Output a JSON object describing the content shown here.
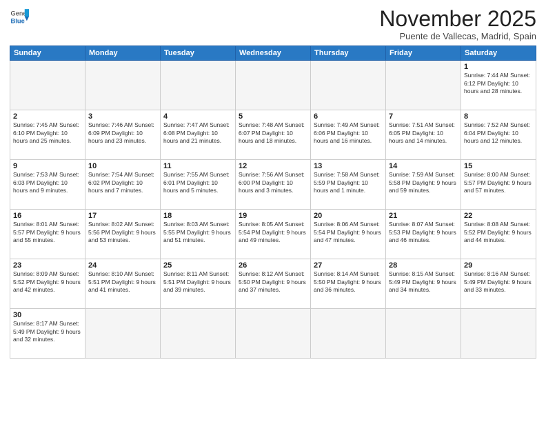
{
  "header": {
    "logo_general": "General",
    "logo_blue": "Blue",
    "title": "November 2025",
    "location": "Puente de Vallecas, Madrid, Spain"
  },
  "weekdays": [
    "Sunday",
    "Monday",
    "Tuesday",
    "Wednesday",
    "Thursday",
    "Friday",
    "Saturday"
  ],
  "weeks": [
    [
      {
        "day": "",
        "info": ""
      },
      {
        "day": "",
        "info": ""
      },
      {
        "day": "",
        "info": ""
      },
      {
        "day": "",
        "info": ""
      },
      {
        "day": "",
        "info": ""
      },
      {
        "day": "",
        "info": ""
      },
      {
        "day": "1",
        "info": "Sunrise: 7:44 AM\nSunset: 6:12 PM\nDaylight: 10 hours\nand 28 minutes."
      }
    ],
    [
      {
        "day": "2",
        "info": "Sunrise: 7:45 AM\nSunset: 6:10 PM\nDaylight: 10 hours\nand 25 minutes."
      },
      {
        "day": "3",
        "info": "Sunrise: 7:46 AM\nSunset: 6:09 PM\nDaylight: 10 hours\nand 23 minutes."
      },
      {
        "day": "4",
        "info": "Sunrise: 7:47 AM\nSunset: 6:08 PM\nDaylight: 10 hours\nand 21 minutes."
      },
      {
        "day": "5",
        "info": "Sunrise: 7:48 AM\nSunset: 6:07 PM\nDaylight: 10 hours\nand 18 minutes."
      },
      {
        "day": "6",
        "info": "Sunrise: 7:49 AM\nSunset: 6:06 PM\nDaylight: 10 hours\nand 16 minutes."
      },
      {
        "day": "7",
        "info": "Sunrise: 7:51 AM\nSunset: 6:05 PM\nDaylight: 10 hours\nand 14 minutes."
      },
      {
        "day": "8",
        "info": "Sunrise: 7:52 AM\nSunset: 6:04 PM\nDaylight: 10 hours\nand 12 minutes."
      }
    ],
    [
      {
        "day": "9",
        "info": "Sunrise: 7:53 AM\nSunset: 6:03 PM\nDaylight: 10 hours\nand 9 minutes."
      },
      {
        "day": "10",
        "info": "Sunrise: 7:54 AM\nSunset: 6:02 PM\nDaylight: 10 hours\nand 7 minutes."
      },
      {
        "day": "11",
        "info": "Sunrise: 7:55 AM\nSunset: 6:01 PM\nDaylight: 10 hours\nand 5 minutes."
      },
      {
        "day": "12",
        "info": "Sunrise: 7:56 AM\nSunset: 6:00 PM\nDaylight: 10 hours\nand 3 minutes."
      },
      {
        "day": "13",
        "info": "Sunrise: 7:58 AM\nSunset: 5:59 PM\nDaylight: 10 hours\nand 1 minute."
      },
      {
        "day": "14",
        "info": "Sunrise: 7:59 AM\nSunset: 5:58 PM\nDaylight: 9 hours\nand 59 minutes."
      },
      {
        "day": "15",
        "info": "Sunrise: 8:00 AM\nSunset: 5:57 PM\nDaylight: 9 hours\nand 57 minutes."
      }
    ],
    [
      {
        "day": "16",
        "info": "Sunrise: 8:01 AM\nSunset: 5:57 PM\nDaylight: 9 hours\nand 55 minutes."
      },
      {
        "day": "17",
        "info": "Sunrise: 8:02 AM\nSunset: 5:56 PM\nDaylight: 9 hours\nand 53 minutes."
      },
      {
        "day": "18",
        "info": "Sunrise: 8:03 AM\nSunset: 5:55 PM\nDaylight: 9 hours\nand 51 minutes."
      },
      {
        "day": "19",
        "info": "Sunrise: 8:05 AM\nSunset: 5:54 PM\nDaylight: 9 hours\nand 49 minutes."
      },
      {
        "day": "20",
        "info": "Sunrise: 8:06 AM\nSunset: 5:54 PM\nDaylight: 9 hours\nand 47 minutes."
      },
      {
        "day": "21",
        "info": "Sunrise: 8:07 AM\nSunset: 5:53 PM\nDaylight: 9 hours\nand 46 minutes."
      },
      {
        "day": "22",
        "info": "Sunrise: 8:08 AM\nSunset: 5:52 PM\nDaylight: 9 hours\nand 44 minutes."
      }
    ],
    [
      {
        "day": "23",
        "info": "Sunrise: 8:09 AM\nSunset: 5:52 PM\nDaylight: 9 hours\nand 42 minutes."
      },
      {
        "day": "24",
        "info": "Sunrise: 8:10 AM\nSunset: 5:51 PM\nDaylight: 9 hours\nand 41 minutes."
      },
      {
        "day": "25",
        "info": "Sunrise: 8:11 AM\nSunset: 5:51 PM\nDaylight: 9 hours\nand 39 minutes."
      },
      {
        "day": "26",
        "info": "Sunrise: 8:12 AM\nSunset: 5:50 PM\nDaylight: 9 hours\nand 37 minutes."
      },
      {
        "day": "27",
        "info": "Sunrise: 8:14 AM\nSunset: 5:50 PM\nDaylight: 9 hours\nand 36 minutes."
      },
      {
        "day": "28",
        "info": "Sunrise: 8:15 AM\nSunset: 5:49 PM\nDaylight: 9 hours\nand 34 minutes."
      },
      {
        "day": "29",
        "info": "Sunrise: 8:16 AM\nSunset: 5:49 PM\nDaylight: 9 hours\nand 33 minutes."
      }
    ],
    [
      {
        "day": "30",
        "info": "Sunrise: 8:17 AM\nSunset: 5:49 PM\nDaylight: 9 hours\nand 32 minutes."
      },
      {
        "day": "",
        "info": ""
      },
      {
        "day": "",
        "info": ""
      },
      {
        "day": "",
        "info": ""
      },
      {
        "day": "",
        "info": ""
      },
      {
        "day": "",
        "info": ""
      },
      {
        "day": "",
        "info": ""
      }
    ]
  ]
}
